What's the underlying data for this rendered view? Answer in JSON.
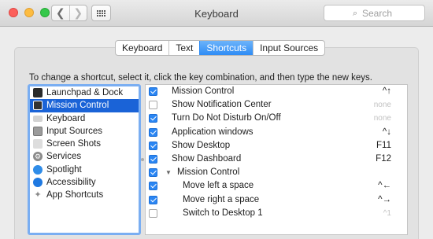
{
  "window": {
    "title": "Keyboard"
  },
  "toolbar": {
    "back_glyph": "❮",
    "forward_glyph": "❯",
    "search_placeholder": "Search",
    "search_glyph": "⌕"
  },
  "tabs": [
    {
      "label": "Keyboard",
      "active": false
    },
    {
      "label": "Text",
      "active": false
    },
    {
      "label": "Shortcuts",
      "active": true
    },
    {
      "label": "Input Sources",
      "active": false
    }
  ],
  "instructions": "To change a shortcut, select it, click the key combination, and then type the new keys.",
  "categories": [
    {
      "label": "Launchpad & Dock",
      "icon": "launchpad-dock-icon",
      "glyph": ""
    },
    {
      "label": "Mission Control",
      "icon": "mission-control-icon",
      "glyph": "",
      "selected": true
    },
    {
      "label": "Keyboard",
      "icon": "keyboard-icon",
      "glyph": ""
    },
    {
      "label": "Input Sources",
      "icon": "input-sources-icon",
      "glyph": ""
    },
    {
      "label": "Screen Shots",
      "icon": "screen-shots-icon",
      "glyph": ""
    },
    {
      "label": "Services",
      "icon": "services-icon",
      "glyph": "⚙"
    },
    {
      "label": "Spotlight",
      "icon": "spotlight-icon",
      "glyph": ""
    },
    {
      "label": "Accessibility",
      "icon": "accessibility-icon",
      "glyph": ""
    },
    {
      "label": "App Shortcuts",
      "icon": "app-shortcuts-icon",
      "glyph": "✦"
    }
  ],
  "shortcuts": [
    {
      "label": "Mission Control",
      "key": "^↑",
      "checked": true
    },
    {
      "label": "Show Notification Center",
      "key": "none",
      "checked": false
    },
    {
      "label": "Turn Do Not Disturb On/Off",
      "key": "none",
      "checked": true
    },
    {
      "label": "Application windows",
      "key": "^↓",
      "checked": true
    },
    {
      "label": "Show Desktop",
      "key": "F11",
      "checked": true
    },
    {
      "label": "Show Dashboard",
      "key": "F12",
      "checked": true
    },
    {
      "label": "Mission Control",
      "key": "",
      "checked": true,
      "group": true
    },
    {
      "label": "Move left a space",
      "key": "^←",
      "checked": true,
      "indent": true
    },
    {
      "label": "Move right a space",
      "key": "^→",
      "checked": true,
      "indent": true
    },
    {
      "label": "Switch to Desktop 1",
      "key": "^1",
      "checked": false,
      "indent": true
    }
  ],
  "colors": {
    "accent": "#2b86f3",
    "selection": "#1a63d7",
    "focus_ring": "#7aaef2"
  }
}
